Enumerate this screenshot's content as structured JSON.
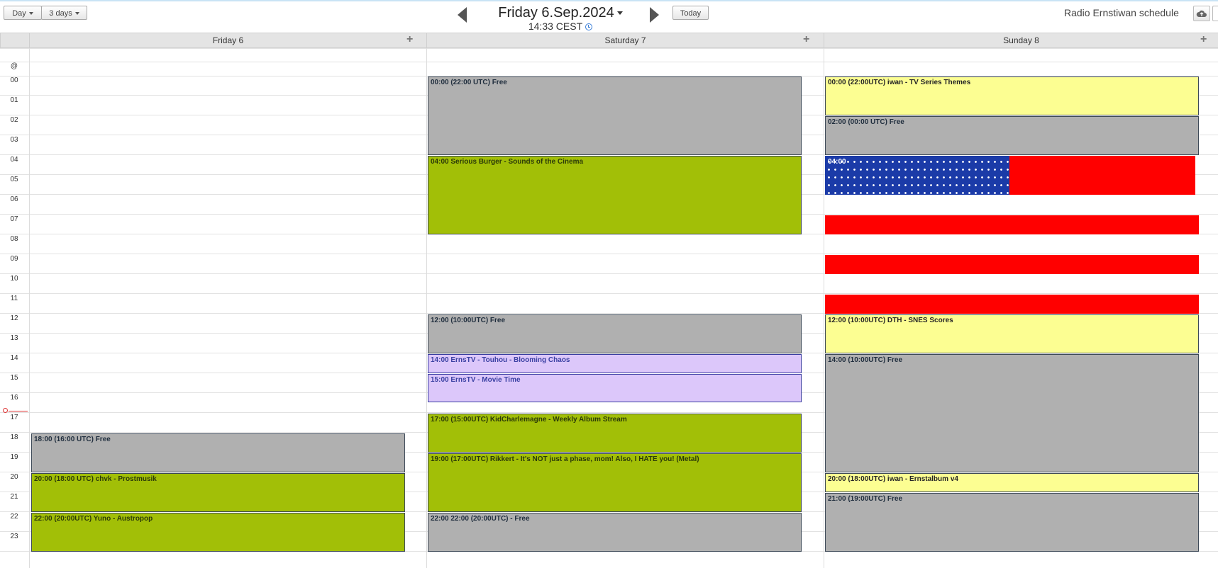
{
  "toolbar": {
    "view_day": "Day",
    "view_days": "3 days",
    "title": "Friday 6.Sep.2024",
    "current_time": "14:33 CEST",
    "today": "Today",
    "calendar_name": "Radio Ernstiwan schedule"
  },
  "days": [
    {
      "label": "Friday 6"
    },
    {
      "label": "Saturday 7"
    },
    {
      "label": "Sunday 8"
    }
  ],
  "allday_marker": "@",
  "hours": [
    "00",
    "01",
    "02",
    "03",
    "04",
    "05",
    "06",
    "07",
    "08",
    "09",
    "10",
    "11",
    "12",
    "13",
    "14",
    "15",
    "16",
    "17",
    "18",
    "19",
    "20",
    "21",
    "22",
    "23"
  ],
  "events": {
    "fri_1": "18:00 (16:00 UTC) Free",
    "fri_2": "20:00 (18:00 UTC) chvk - Prostmusik",
    "fri_3": "22:00 (20:00UTC) Yuno - Austropop",
    "sat_1": "00:00 (22:00 UTC) Free",
    "sat_2": "04:00 Serious Burger - Sounds of the Cinema",
    "sat_3": "12:00 (10:00UTC) Free",
    "sat_4": "14:00 ErnsTV - Touhou - Blooming Chaos",
    "sat_5": "15:00 ErnsTV - Movie Time",
    "sat_6": "17:00 (15:00UTC) KidCharlemagne - Weekly Album Stream",
    "sat_7": "19:00 (17:00UTC) Rikkert - It's NOT just a phase, mom! Also, I HATE you! (Metal)",
    "sat_8": "22:00 22:00 (20:00UTC) - Free",
    "sun_1": "00:00 (22:00UTC) iwan - TV Series Themes",
    "sun_2": "02:00 (00:00 UTC) Free",
    "sun_3": "04:00",
    "sun_4": "12:00 (10:00UTC) DTH - SNES Scores",
    "sun_5": "14:00 (10:00UTC) Free",
    "sun_6": "20:00 (18:00UTC) iwan - Ernstalbum v4",
    "sun_7": "21:00 (19:00UTC) Free"
  },
  "colors": {
    "free": "#b0b0b0",
    "show": "#a2bf07",
    "special": "#fcfe92",
    "ernstv": "#dcc7fa",
    "flag_blue": "#1b3ba8",
    "flag_red": "#ff0000"
  }
}
